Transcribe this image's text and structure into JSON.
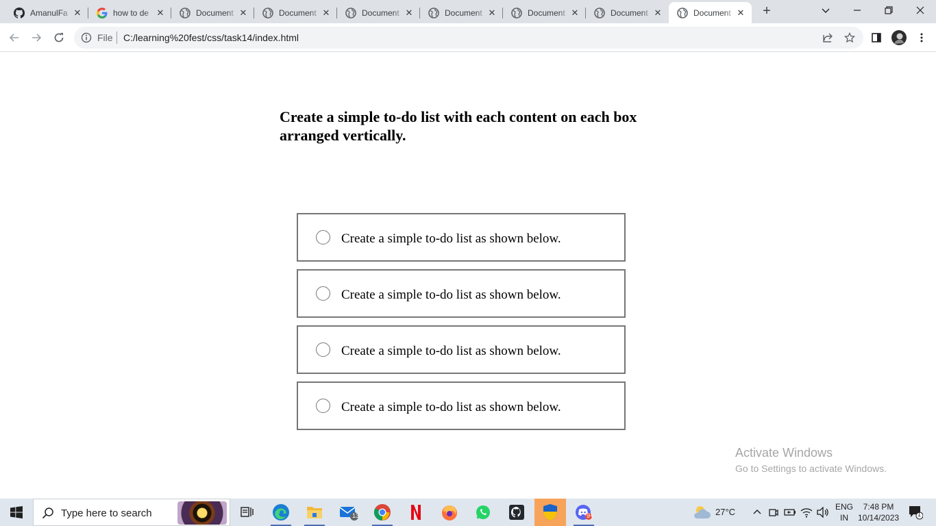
{
  "browser": {
    "tabs": [
      {
        "title": "AmanulFa",
        "favicon": "github-icon",
        "active": false
      },
      {
        "title": "how to de",
        "favicon": "google-icon",
        "active": false
      },
      {
        "title": "Document",
        "favicon": "globe-icon",
        "active": false
      },
      {
        "title": "Document",
        "favicon": "globe-icon",
        "active": false
      },
      {
        "title": "Document",
        "favicon": "globe-icon",
        "active": false
      },
      {
        "title": "Document",
        "favicon": "globe-icon",
        "active": false
      },
      {
        "title": "Document",
        "favicon": "globe-icon",
        "active": false
      },
      {
        "title": "Document",
        "favicon": "globe-icon",
        "active": false
      },
      {
        "title": "Document",
        "favicon": "globe-icon",
        "active": true
      }
    ],
    "new_tab_label": "+",
    "address_bar": {
      "scheme_label": "File",
      "url": "C:/learning%20fest/css/task14/index.html"
    }
  },
  "page": {
    "heading": "Create a simple to-do list with each content on each box arranged vertically.",
    "todo_items": [
      {
        "text": "Create a simple to-do list as shown below.",
        "checked": false
      },
      {
        "text": "Create a simple to-do list as shown below.",
        "checked": false
      },
      {
        "text": "Create a simple to-do list as shown below.",
        "checked": false
      },
      {
        "text": "Create a simple to-do list as shown below.",
        "checked": false
      }
    ]
  },
  "watermark": {
    "title": "Activate Windows",
    "subtitle": "Go to Settings to activate Windows."
  },
  "taskbar": {
    "search_placeholder": "Type here to search",
    "apps": [
      {
        "name": "task-view-icon"
      },
      {
        "name": "edge-icon"
      },
      {
        "name": "file-explorer-icon"
      },
      {
        "name": "mail-icon",
        "badge": "13"
      },
      {
        "name": "chrome-icon"
      },
      {
        "name": "netflix-icon"
      },
      {
        "name": "firefox-icon"
      },
      {
        "name": "whatsapp-icon"
      },
      {
        "name": "github-desktop-icon"
      },
      {
        "name": "security-shield-icon"
      },
      {
        "name": "discord-icon",
        "badge": "9+"
      }
    ],
    "weather": {
      "temperature": "27°C"
    },
    "language": {
      "line1": "ENG",
      "line2": "IN"
    },
    "clock": {
      "time": "7:48 PM",
      "date": "10/14/2023"
    },
    "notifications_count": "1"
  },
  "colors": {
    "tabstrip_bg": "#dee1e6",
    "box_border": "#767676",
    "taskbar_bg": "#dfe6ee",
    "active_app": "#f7a35a"
  }
}
